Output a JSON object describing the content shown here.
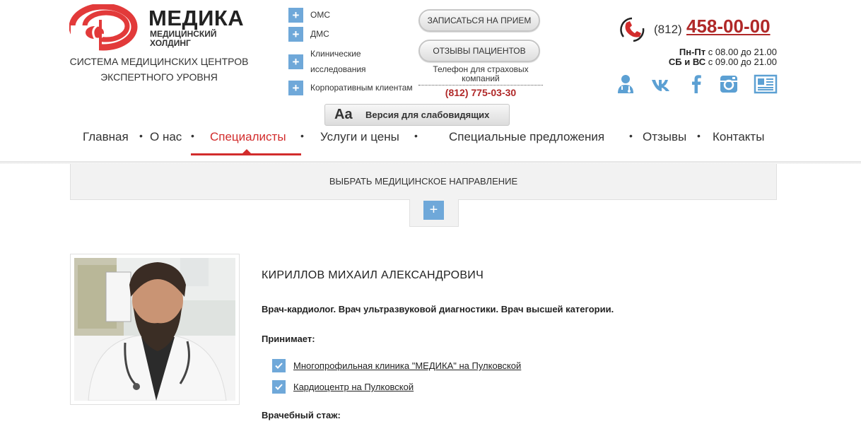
{
  "logo": {
    "name": "МЕДИКА",
    "subtitle": "МЕДИЦИНСКИЙ ХОЛДИНГ"
  },
  "tagline": "СИСТЕМА МЕДИЦИНСКИХ ЦЕНТРОВ ЭКСПЕРТНОГО УРОВНЯ",
  "quick_links": [
    "ОМС",
    "ДМС",
    "Клинические исследования",
    "Корпоративным клиентам"
  ],
  "buttons": {
    "appointment": "ЗАПИСАТЬСЯ НА ПРИЕМ",
    "reviews": "ОТЗЫВЫ ПАЦИЕНТОВ"
  },
  "insurance": {
    "label": "Телефон для страховых компаний",
    "phone": "(812) 775-03-30"
  },
  "contact": {
    "phone_code": "(812)",
    "phone_number": "458-00-00",
    "weekdays_label": "Пн-Пт",
    "weekdays_hours": "с 08.00 до 21.00",
    "weekend_label": "СБ и ВС",
    "weekend_hours": "с 09.00 до 21.00"
  },
  "socials": [
    "doctor-icon",
    "vk-icon",
    "facebook-icon",
    "instagram-icon",
    "news-icon"
  ],
  "accessibility": {
    "icon_text": "Aa",
    "label": "Версия для слабовидящих"
  },
  "nav": {
    "items": [
      "Главная",
      "О нас",
      "Специалисты",
      "Услуги и цены",
      "Специальные предложения",
      "Отзывы",
      "Контакты"
    ],
    "active": "Специалисты",
    "separator": "•"
  },
  "directions": {
    "label": "ВЫБРАТЬ МЕДИЦИНСКОЕ НАПРАВЛЕНИЕ",
    "toggle": "+"
  },
  "doctor": {
    "name": "КИРИЛЛОВ МИХАИЛ АЛЕКСАНДРОВИЧ",
    "specialty": "Врач-кардиолог. Врач ультразвуковой диагностики. Врач высшей категории.",
    "receives_label": "Принимает:",
    "clinics": [
      "Многопрофильная клиника \"МЕДИКА\" на Пулковской",
      "Кардиоцентр на Пулковской"
    ],
    "experience_label": "Врачебный стаж:"
  },
  "colors": {
    "accent_red": "#d22c2c",
    "phone_red": "#b02828",
    "accent_blue": "#6fa8d9",
    "panel_gray": "#f2f2f2"
  }
}
